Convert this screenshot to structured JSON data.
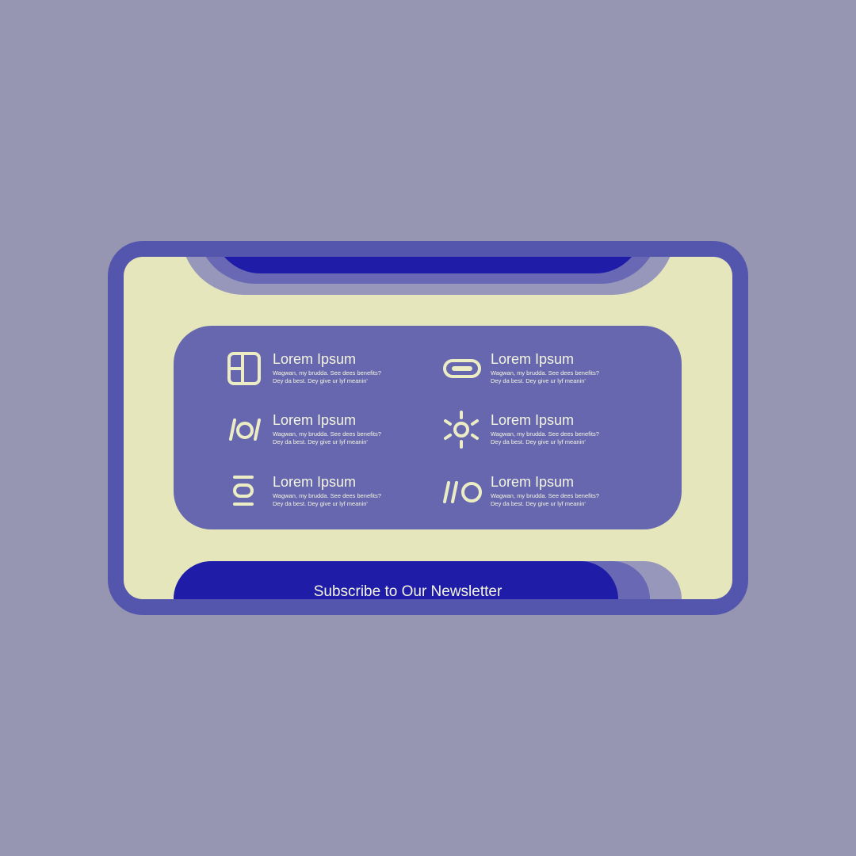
{
  "colors": {
    "background": "#9696b2",
    "frame": "#5455ad",
    "screen": "#e5e6bb",
    "card": "#6767b0",
    "accent": "#1f1da8",
    "icon": "#ecedc4",
    "text": "#f5f6df"
  },
  "features": [
    {
      "icon": "grid-layout-icon",
      "title": "Lorem Ipsum",
      "desc_line1": "Wagwan, my brudda. See dees benefits?",
      "desc_line2": "Dey da best. Dey give ur lyf meanin'"
    },
    {
      "icon": "pill-icon",
      "title": "Lorem Ipsum",
      "desc_line1": "Wagwan, my brudda. See dees benefits?",
      "desc_line2": "Dey da best. Dey give ur lyf meanin'"
    },
    {
      "icon": "slash-circle-slash-icon",
      "title": "Lorem Ipsum",
      "desc_line1": "Wagwan, my brudda. See dees benefits?",
      "desc_line2": "Dey da best. Dey give ur lyf meanin'"
    },
    {
      "icon": "sun-icon",
      "title": "Lorem Ipsum",
      "desc_line1": "Wagwan, my brudda. See dees benefits?",
      "desc_line2": "Dey da best. Dey give ur lyf meanin'"
    },
    {
      "icon": "bars-circle-icon",
      "title": "Lorem Ipsum",
      "desc_line1": "Wagwan, my brudda. See dees benefits?",
      "desc_line2": "Dey da best. Dey give ur lyf meanin'"
    },
    {
      "icon": "slashes-circle-icon",
      "title": "Lorem Ipsum",
      "desc_line1": "Wagwan, my brudda. See dees benefits?",
      "desc_line2": "Dey da best. Dey give ur lyf meanin'"
    }
  ],
  "subscribe": {
    "label": "Subscribe to Our Newsletter"
  }
}
